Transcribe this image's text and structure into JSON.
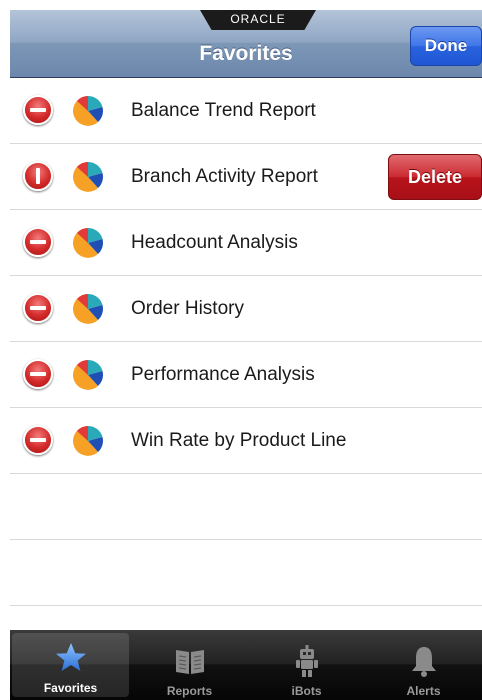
{
  "navbar": {
    "brand": "ORACLE",
    "title": "Favorites",
    "done_label": "Done"
  },
  "list": {
    "items": [
      {
        "label": "Balance Trend Report",
        "icon": "pie-chart-icon"
      },
      {
        "label": "Branch Activity Report",
        "icon": "pie-chart-icon",
        "delete_label": "Delete"
      },
      {
        "label": "Headcount Analysis",
        "icon": "pie-chart-icon"
      },
      {
        "label": "Order History",
        "icon": "pie-chart-icon"
      },
      {
        "label": "Performance Analysis",
        "icon": "pie-chart-icon"
      },
      {
        "label": "Win Rate by Product Line",
        "icon": "pie-chart-icon"
      }
    ]
  },
  "tabbar": {
    "tabs": [
      {
        "label": "Favorites",
        "icon": "star-icon",
        "active": true
      },
      {
        "label": "Reports",
        "icon": "book-icon",
        "active": false
      },
      {
        "label": "iBots",
        "icon": "robot-icon",
        "active": false
      },
      {
        "label": "Alerts",
        "icon": "bell-icon",
        "active": false
      }
    ]
  },
  "colors": {
    "navbar": "#8fa6c3",
    "done_button": "#2a63dd",
    "delete_button": "#cc2a31",
    "minus_icon": "#d42a2a",
    "tabbar": "#1a1a1a",
    "star": "#4a8fe8"
  }
}
